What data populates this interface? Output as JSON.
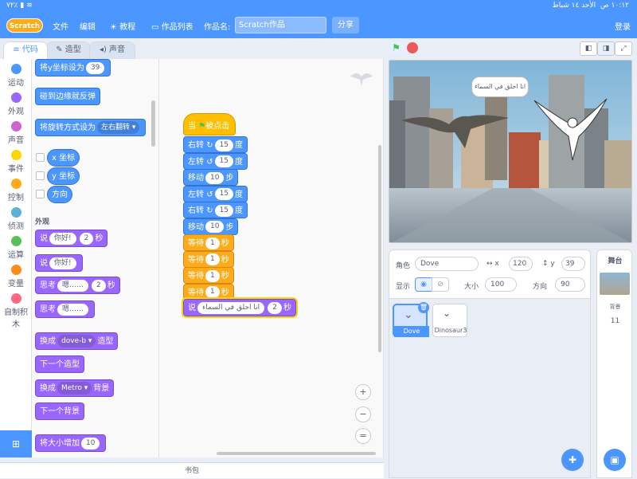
{
  "status": {
    "time": "١٠:١٢ ص",
    "date": "الأحد ١٤ شباط",
    "battery": "٧٢٪"
  },
  "menubar": {
    "logo": "Scratch",
    "file": "文件",
    "edit": "编辑",
    "tutorials": "教程",
    "project_list": "作品列表",
    "title_label": "作品名:",
    "title_value": "Scratch作品",
    "share": "分享",
    "login": "登录"
  },
  "tabs": {
    "code": "代码",
    "costumes": "造型",
    "sounds": "声音"
  },
  "categories": [
    {
      "label": "运动",
      "color": "#4c97ff"
    },
    {
      "label": "外观",
      "color": "#9966ff"
    },
    {
      "label": "声音",
      "color": "#cf63cf"
    },
    {
      "label": "事件",
      "color": "#ffd500"
    },
    {
      "label": "控制",
      "color": "#ffab19"
    },
    {
      "label": "侦测",
      "color": "#5cb1d6"
    },
    {
      "label": "运算",
      "color": "#59c059"
    },
    {
      "label": "变量",
      "color": "#ff8c1a"
    },
    {
      "label": "自制积木",
      "color": "#ff6680"
    }
  ],
  "palette": {
    "set_y": {
      "text": "将y坐标设为",
      "value": "39"
    },
    "bounce": "碰到边缘就反弹",
    "rotation": {
      "text": "将旋转方式设为",
      "value": "左右翻转"
    },
    "x_pos": "x 坐标",
    "y_pos": "y 坐标",
    "direction": "方向",
    "looks_label": "外观",
    "say_for": {
      "text": "说",
      "msg": "你好!",
      "secs": "2",
      "unit": "秒"
    },
    "say": {
      "text": "说",
      "msg": "你好!"
    },
    "think_for": {
      "text": "思考",
      "msg": "嗯……",
      "secs": "2",
      "unit": "秒"
    },
    "think": {
      "text": "思考",
      "msg": "嗯……"
    },
    "switch_costume": {
      "text": "换成",
      "value": "dove-b",
      "suffix": "造型"
    },
    "next_costume": "下一个造型",
    "switch_backdrop": {
      "text": "换成",
      "value": "Metro",
      "suffix": "背景"
    },
    "next_backdrop": "下一个背景",
    "change_size": {
      "text": "将大小增加",
      "value": "10"
    }
  },
  "script": {
    "hat": {
      "prefix": "当",
      "suffix": "被点击"
    },
    "blocks": [
      {
        "text": "右转",
        "arrow": "↻",
        "value": "15",
        "unit": "度",
        "color": "blue"
      },
      {
        "text": "左转",
        "arrow": "↺",
        "value": "15",
        "unit": "度",
        "color": "blue"
      },
      {
        "text": "移动",
        "arrow": "",
        "value": "10",
        "unit": "步",
        "color": "blue"
      },
      {
        "text": "左转",
        "arrow": "↺",
        "value": "15",
        "unit": "度",
        "color": "blue"
      },
      {
        "text": "右转",
        "arrow": "↻",
        "value": "15",
        "unit": "度",
        "color": "blue"
      },
      {
        "text": "移动",
        "arrow": "",
        "value": "10",
        "unit": "步",
        "color": "blue"
      },
      {
        "text": "等待",
        "arrow": "",
        "value": "1",
        "unit": "秒",
        "color": "orange"
      },
      {
        "text": "等待",
        "arrow": "",
        "value": "1",
        "unit": "秒",
        "color": "orange"
      },
      {
        "text": "等待",
        "arrow": "",
        "value": "1",
        "unit": "秒",
        "color": "orange"
      },
      {
        "text": "等待",
        "arrow": "",
        "value": "1",
        "unit": "秒",
        "color": "orange"
      }
    ],
    "say": {
      "text": "说",
      "msg": "انا احلق في السماء",
      "secs": "2",
      "unit": "秒"
    }
  },
  "zoom": {
    "in": "+",
    "out": "−",
    "reset": "="
  },
  "backpack": "书包",
  "stage": {
    "bubble": "انا احلق في السماء"
  },
  "sprite_info": {
    "sprite_label": "角色",
    "sprite_name": "Dove",
    "x_label": "x",
    "x_value": "120",
    "y_label": "y",
    "y_value": "39",
    "show_label": "显示",
    "size_label": "大小",
    "size_value": "100",
    "direction_label": "方向",
    "direction_value": "90"
  },
  "sprites": [
    {
      "name": "Dove",
      "selected": true
    },
    {
      "name": "Dinosaur3",
      "selected": false
    }
  ],
  "stage_panel": {
    "title": "舞台",
    "backdrops_label": "背景",
    "backdrops_count": "11"
  }
}
